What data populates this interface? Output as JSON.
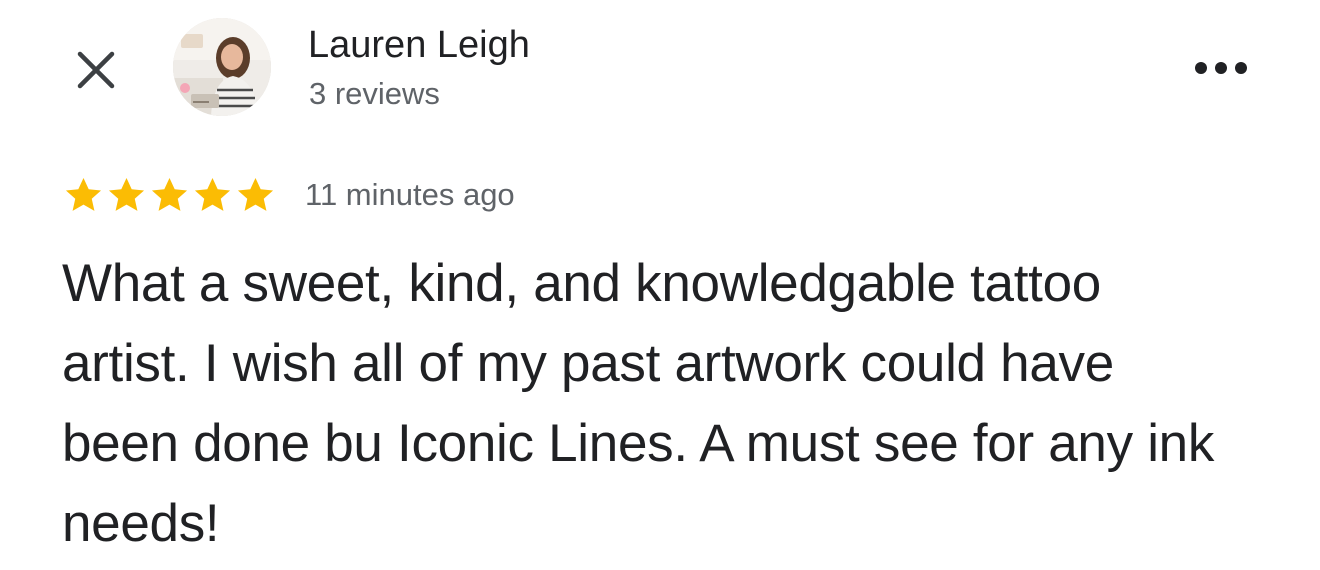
{
  "header": {
    "close_icon": "close-icon",
    "more_icon": "more-horizontal-icon",
    "user_name": "Lauren Leigh",
    "reviews_count": "3 reviews"
  },
  "review": {
    "rating": 5,
    "max_rating": 5,
    "time_ago": "11 minutes ago",
    "text": "What a sweet, kind, and knowledgable tattoo artist. I wish all of my past artwork could have been done bu Iconic Lines. A must see for any ink needs!"
  },
  "colors": {
    "star": "#fbbc04",
    "primary_text": "#202124",
    "secondary_text": "#5f6368",
    "icon": "#3c4043"
  }
}
